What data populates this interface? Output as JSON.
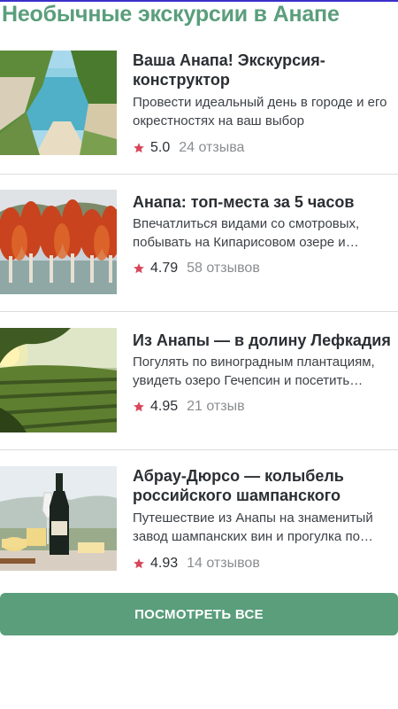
{
  "page": {
    "title": "Необычные экскурсии в Анапе",
    "accent_color": "#5a9e7b",
    "star_color": "#d9465b"
  },
  "tours": [
    {
      "title": "Ваша Анапа! Экскурсия-конструктор",
      "description": "Провести идеальный день в городе и его окрестностях на ваш выбор",
      "rating": "5.0",
      "reviews": "24 отзыва",
      "image": "coastal-cliff-path-photo"
    },
    {
      "title": "Анапа: топ-места за 5 часов",
      "description": "Впечатлиться видами со смотровых, побывать на Кипарисовом озере и испытать…",
      "rating": "4.79",
      "reviews": "58 отзывов",
      "image": "cypress-lake-photo"
    },
    {
      "title": "Из Анапы — в долину Лефкадия",
      "description": "Погулять по виноградным плантациям, увидеть озеро Гечепсин и посетить музей…",
      "rating": "4.95",
      "reviews": "21 отзыв",
      "image": "vineyard-sunset-photo"
    },
    {
      "title": "Абрау-Дюрсо — колыбель российского шампанского",
      "description": "Путешествие из Анапы на знаменитый завод шампанских вин и прогулка по…",
      "rating": "4.93",
      "reviews": "14 отзывов",
      "image": "champagne-cheese-photo"
    }
  ],
  "show_all_button": "ПОСМОТРЕТЬ ВСЕ"
}
